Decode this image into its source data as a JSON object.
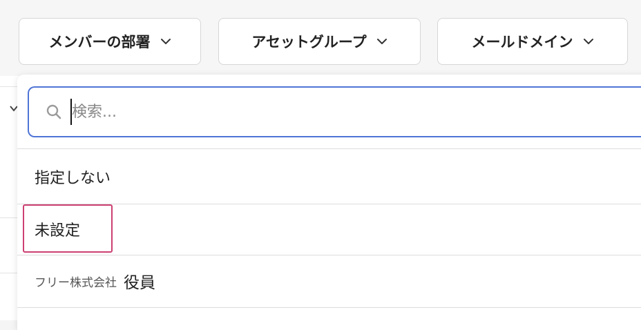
{
  "filters": [
    {
      "label": "メンバーの部署"
    },
    {
      "label": "アセットグループ"
    },
    {
      "label": "メールドメイン"
    }
  ],
  "dropdown": {
    "search": {
      "placeholder": "検索...",
      "value": ""
    },
    "options": [
      {
        "label": "指定しない"
      },
      {
        "label": "未設定"
      },
      {
        "company": "フリー株式会社",
        "role": "役員"
      }
    ]
  },
  "colors": {
    "focus_border": "#4f74d6",
    "highlight": "#cc3f72"
  },
  "icons": {
    "search": "search-icon",
    "chevron": "chevron-down-icon"
  }
}
